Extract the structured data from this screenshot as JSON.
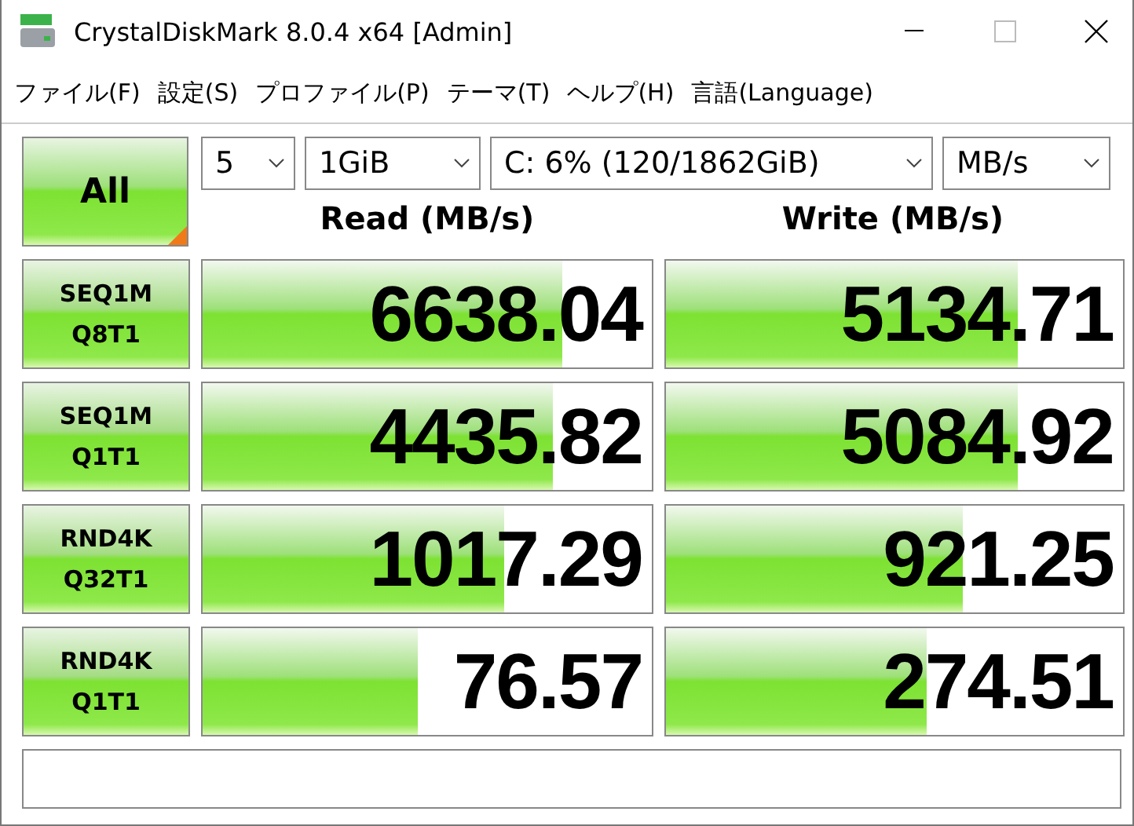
{
  "window": {
    "title": "CrystalDiskMark 8.0.4 x64 [Admin]"
  },
  "menu": [
    "ファイル(F)",
    "設定(S)",
    "プロファイル(P)",
    "テーマ(T)",
    "ヘルプ(H)",
    "言語(Language)"
  ],
  "all_button": "All",
  "selectors": [
    {
      "value": "5"
    },
    {
      "value": "1GiB"
    },
    {
      "value": "C: 6% (120/1862GiB)"
    },
    {
      "value": "MB/s"
    }
  ],
  "columns": [
    "Read (MB/s)",
    "Write (MB/s)"
  ],
  "rows": [
    {
      "test": [
        "SEQ1M",
        "Q8T1"
      ],
      "read": {
        "value": "6638.04",
        "level": 0.8
      },
      "write": {
        "value": "5134.71",
        "level": 0.77
      }
    },
    {
      "test": [
        "SEQ1M",
        "Q1T1"
      ],
      "read": {
        "value": "4435.82",
        "level": 0.78
      },
      "write": {
        "value": "5084.92",
        "level": 0.77
      }
    },
    {
      "test": [
        "RND4K",
        "Q32T1"
      ],
      "read": {
        "value": "1017.29",
        "level": 0.67
      },
      "write": {
        "value": "921.25",
        "level": 0.65
      }
    },
    {
      "test": [
        "RND4K",
        "Q1T1"
      ],
      "read": {
        "value": "76.57",
        "level": 0.48
      },
      "write": {
        "value": "274.51",
        "level": 0.57
      }
    }
  ]
}
